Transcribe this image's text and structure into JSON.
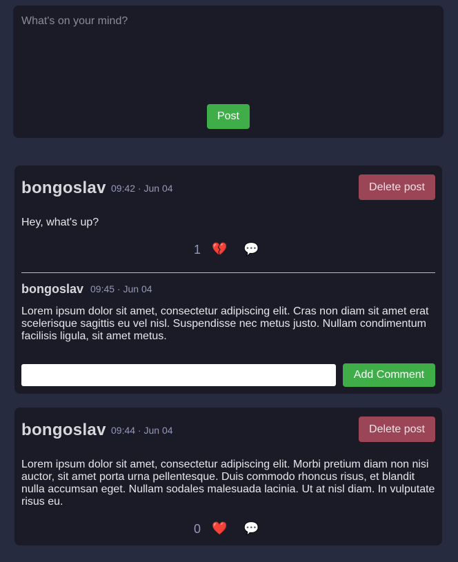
{
  "composer": {
    "placeholder": "What's on your mind?",
    "post_label": "Post"
  },
  "posts": [
    {
      "author": "bongoslav",
      "time": "09:42 · Jun 04",
      "delete_label": "Delete post",
      "text": "Hey, what's up?",
      "like_count": "1",
      "heart_icon": "💔",
      "comment_icon": "💬",
      "comments": [
        {
          "author": "bongoslav",
          "time": "09:45 · Jun 04",
          "text": "Lorem ipsum dolor sit amet, consectetur adipiscing elit. Cras non diam sit amet erat scelerisque sagittis eu vel nisl. Suspendisse nec metus justo. Nullam condimentum facilisis ligula, sit amet metus."
        }
      ],
      "comment_input_value": "",
      "add_comment_label": "Add Comment"
    },
    {
      "author": "bongoslav",
      "time": "09:44 · Jun 04",
      "delete_label": "Delete post",
      "text": "Lorem ipsum dolor sit amet, consectetur adipiscing elit. Morbi pretium diam non nisi auctor, sit amet porta urna pellentesque. Duis commodo rhoncus risus, et blandit nulla accumsan eget. Nullam sodales malesuada lacinia. Ut at nisl diam. In vulputate risus eu.",
      "like_count": "0",
      "heart_icon": "❤️",
      "comment_icon": "💬"
    }
  ],
  "colors": {
    "background": "#262b3f",
    "card": "#1b1b28",
    "accent_green": "#3fae49",
    "delete_red": "#9b4556",
    "muted_text": "#9598b8"
  }
}
